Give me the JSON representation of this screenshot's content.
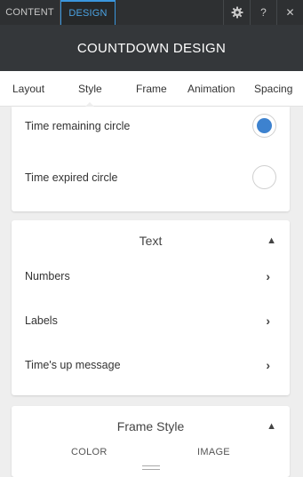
{
  "top_tabs": [
    {
      "label": "CONTENT"
    },
    {
      "label": "DESIGN",
      "active": true
    }
  ],
  "top_icons": {
    "settings": "gear-icon",
    "help": "?",
    "close": "✕"
  },
  "header": {
    "title": "COUNTDOWN DESIGN"
  },
  "nav_tabs": [
    {
      "label": "Layout"
    },
    {
      "label": "Style",
      "active": true
    },
    {
      "label": "Frame"
    },
    {
      "label": "Animation"
    },
    {
      "label": "Spacing"
    }
  ],
  "circle_options": [
    {
      "label": "Time remaining circle",
      "selected": true
    },
    {
      "label": "Time expired circle",
      "selected": false
    }
  ],
  "text_section": {
    "title": "Text",
    "items": [
      {
        "label": "Numbers"
      },
      {
        "label": "Labels"
      },
      {
        "label": "Time's up message"
      }
    ]
  },
  "frame_style_section": {
    "title": "Frame Style",
    "tabs": [
      {
        "label": "COLOR"
      },
      {
        "label": "IMAGE"
      }
    ]
  },
  "colors": {
    "accent": "#3a96dd",
    "selected_radio": "#3d82cf",
    "header_bg": "#34373a"
  }
}
